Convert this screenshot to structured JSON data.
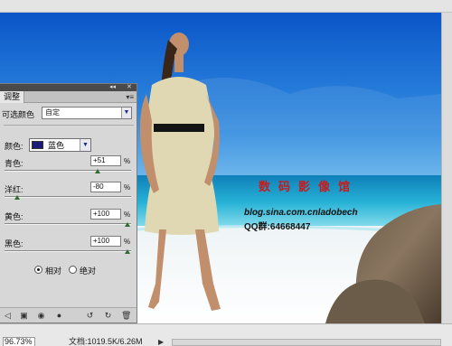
{
  "panel": {
    "tab": "调整",
    "title": "可选颜色",
    "preset": "自定",
    "color_label": "颜色:",
    "color_value": "蓝色",
    "color_hex": "#1a1c78",
    "sliders": [
      {
        "label": "青色:",
        "value": "+51",
        "unit": "%",
        "level": 0.755
      },
      {
        "label": "洋红:",
        "value": "-80",
        "unit": "%",
        "level": 0.1
      },
      {
        "label": "黄色:",
        "value": "+100",
        "unit": "%",
        "level": 1.0
      },
      {
        "label": "黑色:",
        "value": "+100",
        "unit": "%",
        "level": 1.0
      }
    ],
    "method_relative": "相对",
    "method_absolute": "绝对",
    "method_selected": "relative"
  },
  "watermark": {
    "title": "数码影像馆",
    "url": "blog.sina.com.cnladobech",
    "qq": "QQ群:64668447"
  },
  "status": {
    "zoom": "96.73%",
    "doc": "文档:1019.5K/6.26M"
  }
}
